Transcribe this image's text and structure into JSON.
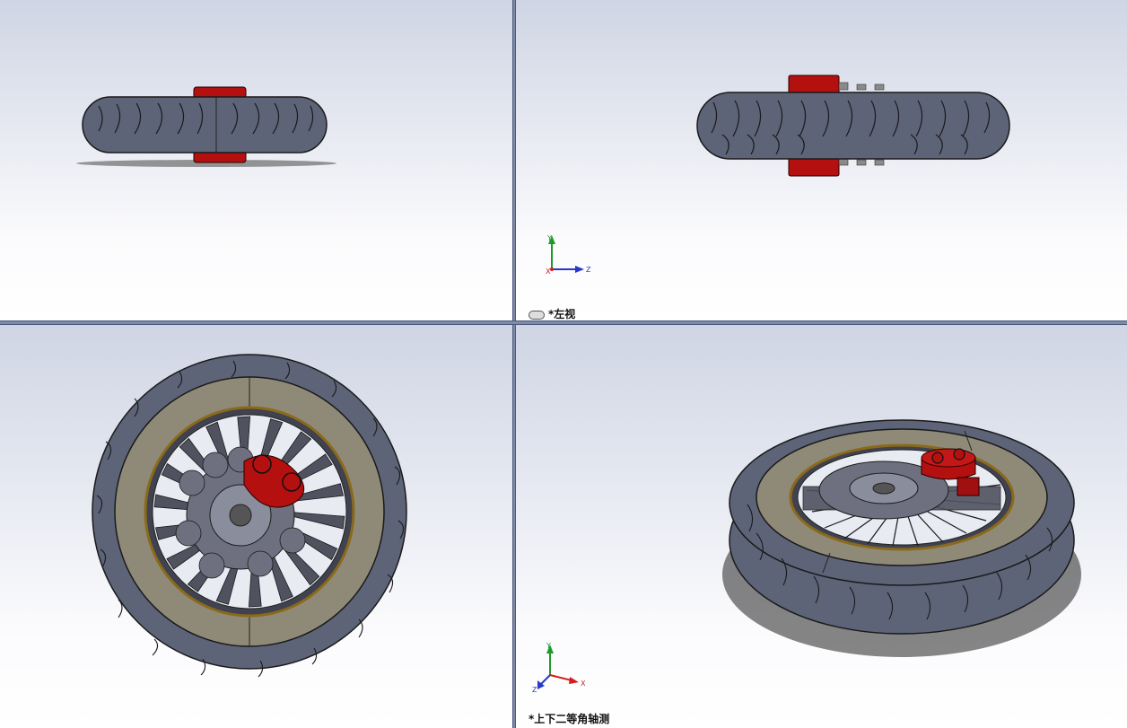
{
  "viewports": {
    "top_left": {
      "label": ""
    },
    "top_right": {
      "label": "*左视",
      "triad": {
        "y": "Y",
        "z": "Z",
        "x": "X"
      }
    },
    "bottom_left": {
      "label": ""
    },
    "bottom_right": {
      "label": "*上下二等角轴测",
      "triad": {
        "y": "Y",
        "x": "X",
        "z": "Z"
      }
    }
  },
  "icons": {
    "view_link": "link-icon",
    "triad": "coordinate-triad-icon"
  },
  "colors": {
    "tire": "#5d6478",
    "rim": "#8f8a78",
    "caliper": "#b41010",
    "disc": "#6e7080",
    "axis_x": "#d21e1e",
    "axis_y": "#1e9a2a",
    "axis_z": "#2838c8"
  }
}
